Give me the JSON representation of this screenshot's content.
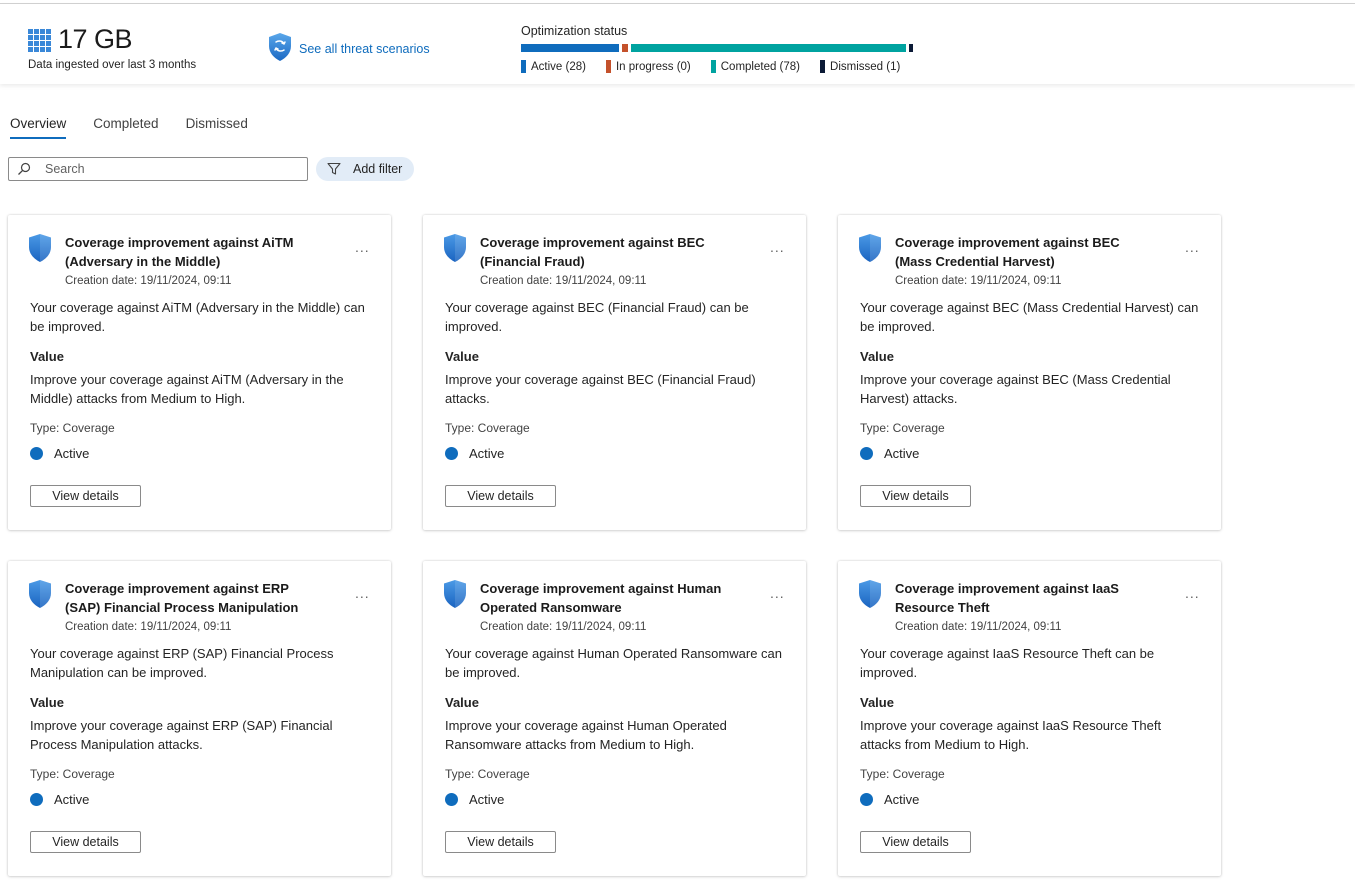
{
  "summary": {
    "data_ingested_value": "17 GB",
    "data_ingested_caption": "Data ingested over last 3 months",
    "threat_link_label": "See all threat scenarios"
  },
  "optimization_status": {
    "title": "Optimization status",
    "segments": [
      {
        "label": "Active (28)",
        "count": 28,
        "color": "#0f6cbd"
      },
      {
        "label": "In progress (0)",
        "count": 0,
        "color": "#c4512b"
      },
      {
        "label": "Completed (78)",
        "count": 78,
        "color": "#00a3a0"
      },
      {
        "label": "Dismissed (1)",
        "count": 1,
        "color": "#0b1a36"
      }
    ]
  },
  "tabs": [
    {
      "label": "Overview",
      "active": true
    },
    {
      "label": "Completed",
      "active": false
    },
    {
      "label": "Dismissed",
      "active": false
    }
  ],
  "search": {
    "placeholder": "Search"
  },
  "filter": {
    "label": "Add filter"
  },
  "cards": [
    {
      "title": "Coverage improvement against AiTM (Adversary in the Middle)",
      "date": "Creation date: 19/11/2024, 09:11",
      "description": "Your coverage against AiTM (Adversary in the Middle) can be improved.",
      "value_heading": "Value",
      "value": "Improve your coverage against AiTM (Adversary in the Middle) attacks from Medium to High.",
      "type": "Type: Coverage",
      "status": "Active",
      "button": "View details",
      "more": "..."
    },
    {
      "title": "Coverage improvement against BEC (Financial Fraud)",
      "date": "Creation date: 19/11/2024, 09:11",
      "description": "Your coverage against BEC (Financial Fraud) can be improved.",
      "value_heading": "Value",
      "value": "Improve your coverage against BEC (Financial Fraud) attacks.",
      "type": "Type: Coverage",
      "status": "Active",
      "button": "View details",
      "more": "..."
    },
    {
      "title": "Coverage improvement against BEC (Mass Credential Harvest)",
      "date": "Creation date: 19/11/2024, 09:11",
      "description": "Your coverage against BEC (Mass Credential Harvest) can be improved.",
      "value_heading": "Value",
      "value": "Improve your coverage against BEC (Mass Credential Harvest) attacks.",
      "type": "Type: Coverage",
      "status": "Active",
      "button": "View details",
      "more": "..."
    },
    {
      "title": "Coverage improvement against ERP (SAP) Financial Process Manipulation",
      "date": "Creation date: 19/11/2024, 09:11",
      "description": "Your coverage against ERP (SAP) Financial Process Manipulation can be improved.",
      "value_heading": "Value",
      "value": "Improve your coverage against ERP (SAP) Financial Process Manipulation attacks.",
      "type": "Type: Coverage",
      "status": "Active",
      "button": "View details",
      "more": "..."
    },
    {
      "title": "Coverage improvement against Human Operated Ransomware",
      "date": "Creation date: 19/11/2024, 09:11",
      "description": "Your coverage against Human Operated Ransomware can be improved.",
      "value_heading": "Value",
      "value": "Improve your coverage against Human Operated Ransomware attacks from Medium to High.",
      "type": "Type: Coverage",
      "status": "Active",
      "button": "View details",
      "more": "..."
    },
    {
      "title": "Coverage improvement against IaaS Resource Theft",
      "date": "Creation date: 19/11/2024, 09:11",
      "description": "Your coverage against IaaS Resource Theft can be improved.",
      "value_heading": "Value",
      "value": "Improve your coverage against IaaS Resource Theft attacks from Medium to High.",
      "type": "Type: Coverage",
      "status": "Active",
      "button": "View details",
      "more": "..."
    }
  ]
}
